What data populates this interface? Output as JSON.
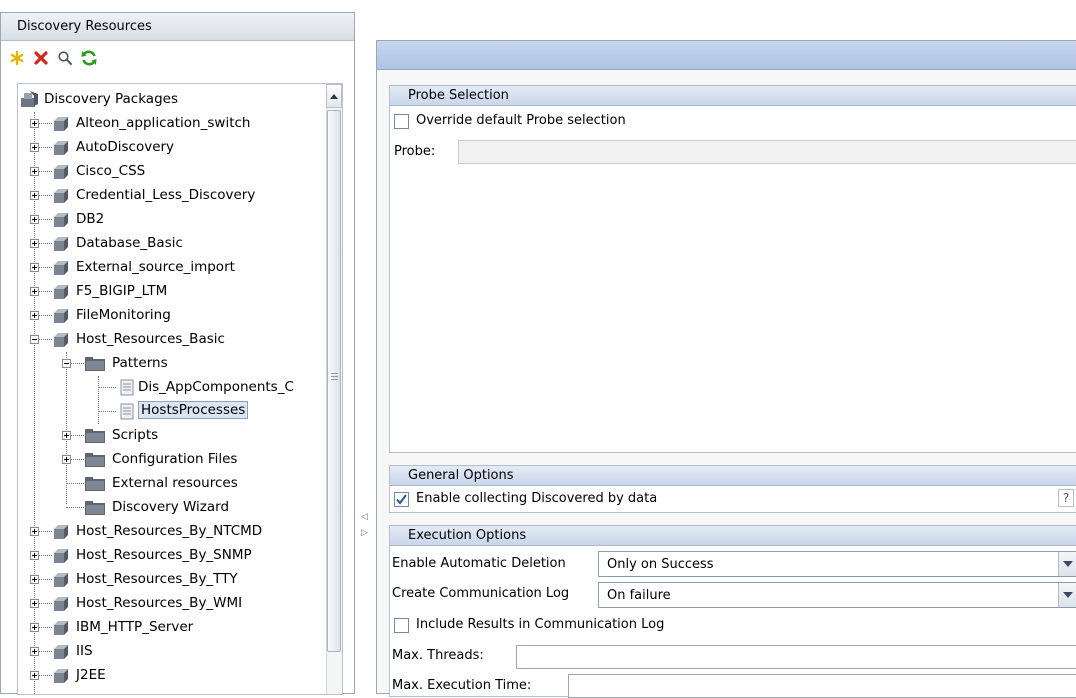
{
  "left_panel": {
    "title": "Discovery Resources",
    "toolbar": {
      "new_icon": "asterisk-icon",
      "delete_icon": "red-x-icon",
      "search_icon": "magnifier-icon",
      "refresh_icon": "green-refresh-icon"
    },
    "tree": {
      "root": "Discovery Packages",
      "packages": [
        "Alteon_application_switch",
        "AutoDiscovery",
        "Cisco_CSS",
        "Credential_Less_Discovery",
        "DB2",
        "Database_Basic",
        "External_source_import",
        "F5_BIGIP_LTM",
        "FileMonitoring",
        "Host_Resources_Basic"
      ],
      "expanded_children": {
        "patterns": "Patterns",
        "pattern_files": [
          "Dis_AppComponents_C",
          "HostsProcesses"
        ],
        "scripts": "Scripts",
        "configuration_files": "Configuration Files",
        "external_resources": "External resources",
        "discovery_wizard": "Discovery Wizard"
      },
      "more_packages": [
        "Host_Resources_By_NTCMD",
        "Host_Resources_By_SNMP",
        "Host_Resources_By_TTY",
        "Host_Resources_By_WMI",
        "IBM_HTTP_Server",
        "IIS",
        "J2EE"
      ]
    }
  },
  "right_panel": {
    "probe_selection": {
      "title": "Probe Selection",
      "override_label": "Override default Probe selection",
      "override_checked": false,
      "probe_label": "Probe:",
      "probe_value": ""
    },
    "general_options": {
      "title": "General Options",
      "collect_label": "Enable collecting Discovered by data",
      "collect_checked": true,
      "help_glyph": "?"
    },
    "execution_options": {
      "title": "Execution Options",
      "auto_delete_label": "Enable Automatic Deletion",
      "auto_delete_value": "Only on Success",
      "comm_log_label": "Create Communication Log",
      "comm_log_value": "On failure",
      "include_results_label": "Include Results in Communication Log",
      "include_results_checked": false,
      "max_threads_label": "Max. Threads:",
      "max_threads_value": "",
      "max_exec_label": "Max. Execution Time:",
      "max_exec_value": ""
    }
  },
  "colors": {
    "header_blue": "#aec3e4",
    "section_header": "#c9d6ea",
    "selection": "#dbe6f5"
  }
}
